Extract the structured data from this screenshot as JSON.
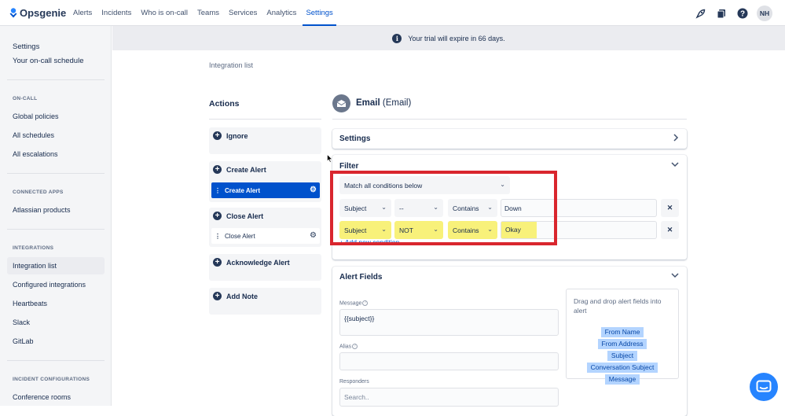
{
  "brand": {
    "name": "Opsgenie"
  },
  "nav": {
    "items": [
      {
        "label": "Alerts"
      },
      {
        "label": "Incidents"
      },
      {
        "label": "Who is on-call"
      },
      {
        "label": "Teams"
      },
      {
        "label": "Services"
      },
      {
        "label": "Analytics"
      },
      {
        "label": "Settings",
        "active": true
      }
    ],
    "icons": [
      "rocket-icon",
      "docs-icon",
      "help-icon"
    ],
    "avatar_initials": "NH"
  },
  "sidebar": {
    "title": "Settings",
    "schedule_link": "Your on-call schedule",
    "sections": [
      {
        "heading": "ON-CALL",
        "items": [
          "Global policies",
          "All schedules",
          "All escalations"
        ]
      },
      {
        "heading": "CONNECTED APPS",
        "items": [
          "Atlassian products"
        ]
      },
      {
        "heading": "INTEGRATIONS",
        "items": [
          "Integration list",
          "Configured integrations",
          "Heartbeats",
          "Slack",
          "GitLab"
        ]
      },
      {
        "heading": "INCIDENT CONFIGURATIONS",
        "items": [
          "Conference rooms"
        ]
      }
    ],
    "active_item": "Integration list"
  },
  "banner": {
    "text": "Your trial will expire in 66 days."
  },
  "breadcrumb": "Integration list",
  "actions": {
    "heading": "Actions",
    "cards": [
      {
        "title": "Ignore"
      },
      {
        "title": "Create Alert",
        "selected": "Create Alert"
      },
      {
        "title": "Close Alert",
        "selected": "Close Alert"
      },
      {
        "title": "Acknowledge Alert"
      },
      {
        "title": "Add Note"
      }
    ]
  },
  "integration": {
    "name": "Email",
    "type": "(Email)"
  },
  "settings_panel": {
    "title": "Settings"
  },
  "filter": {
    "title": "Filter",
    "match_mode": "Match all conditions below",
    "conditions": [
      {
        "field": "Subject",
        "operator_not": "--",
        "operation": "Contains",
        "value": "Down"
      },
      {
        "field": "Subject",
        "operator_not": "NOT",
        "operation": "Contains",
        "value": "Okay",
        "highlighted": true
      }
    ],
    "remove_label": "✕",
    "add_condition": "+ Add new condition",
    "highlight_box_color": "#d9262e",
    "highlight_fill_color": "#f8f17a"
  },
  "alert_fields": {
    "title": "Alert Fields",
    "message_label": "Message",
    "message_value": "{{subject}}",
    "alias_label": "Alias",
    "alias_value": "",
    "responders_label": "Responders",
    "responders_placeholder": "Search..",
    "drag_hint": "Drag and drop alert fields into alert",
    "drag_fields": [
      "From Name",
      "From Address",
      "Subject",
      "Conversation Subject",
      "Message"
    ]
  },
  "colors": {
    "accent": "#0052cc",
    "chat": "#2684ff"
  }
}
